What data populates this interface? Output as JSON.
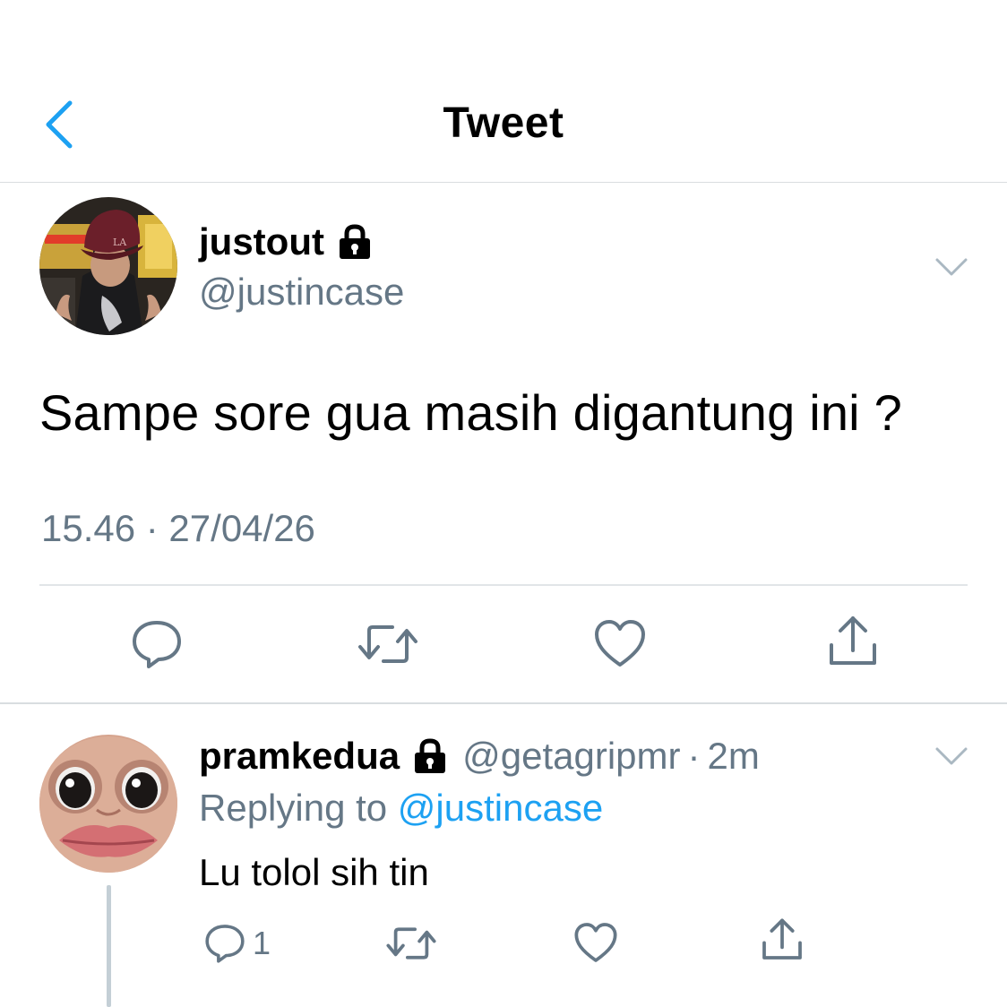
{
  "header": {
    "title": "Tweet",
    "back_icon": "chevron-left-icon"
  },
  "colors": {
    "accent": "#1da1f2",
    "secondary_text": "#657786",
    "divider": "#d9dde0",
    "thread_line": "#c4cfd6"
  },
  "tweet": {
    "display_name": "justout",
    "handle": "@justincase",
    "protected_icon": "lock-icon",
    "text": "Sampe sore gua masih digantung ini ?",
    "timestamp": "15.46 · 27/04/26",
    "actions": [
      {
        "name": "reply",
        "icon": "comment-icon"
      },
      {
        "name": "retweet",
        "icon": "retweet-icon"
      },
      {
        "name": "like",
        "icon": "heart-icon"
      },
      {
        "name": "share",
        "icon": "share-icon"
      }
    ]
  },
  "reply": {
    "display_name": "pramkedua",
    "handle": "@getagripmr",
    "time": "2m",
    "separator": "·",
    "replying_label": "Replying to",
    "replying_to": "@justincase",
    "text": "Lu tolol sih tin",
    "reply_count": "1",
    "actions": [
      {
        "name": "reply",
        "icon": "comment-icon"
      },
      {
        "name": "retweet",
        "icon": "retweet-icon"
      },
      {
        "name": "like",
        "icon": "heart-icon"
      },
      {
        "name": "share",
        "icon": "share-icon"
      }
    ]
  }
}
